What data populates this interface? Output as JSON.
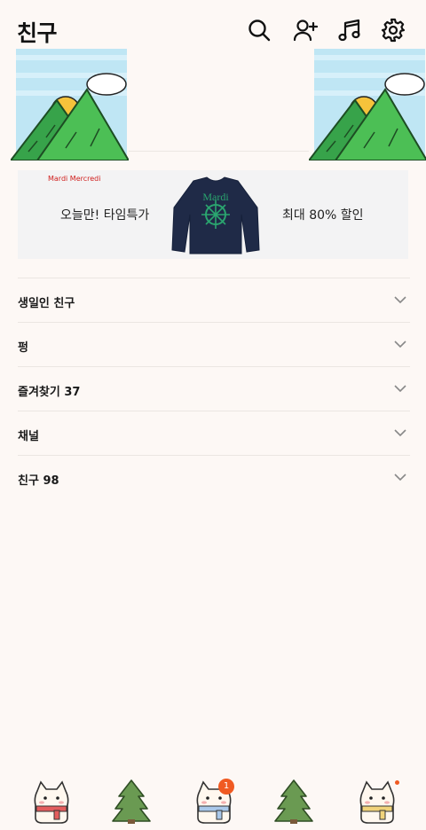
{
  "header": {
    "title": "친구",
    "icons": [
      "search-icon",
      "add-friend-icon",
      "music-icon",
      "settings-icon"
    ]
  },
  "banner": {
    "brand": "Mardi Mercredi",
    "left_text": "오늘만! 타임특가",
    "right_text": "최대 80% 할인",
    "product_text": "Mardi"
  },
  "sections": [
    {
      "label": "생일인 친구"
    },
    {
      "label": "펑"
    },
    {
      "label": "즐겨찾기 37"
    },
    {
      "label": "채널"
    },
    {
      "label": "친구 98"
    }
  ],
  "tabbar": {
    "chats_badge": "1",
    "tabs": [
      "friends-tab",
      "tree-tab",
      "chats-tab",
      "tree-tab",
      "more-tab"
    ]
  },
  "colors": {
    "background": "#fdf8f5",
    "badge": "#f05a22",
    "brand_red": "#d0201e",
    "banner_bg": "#f3f3f4"
  }
}
